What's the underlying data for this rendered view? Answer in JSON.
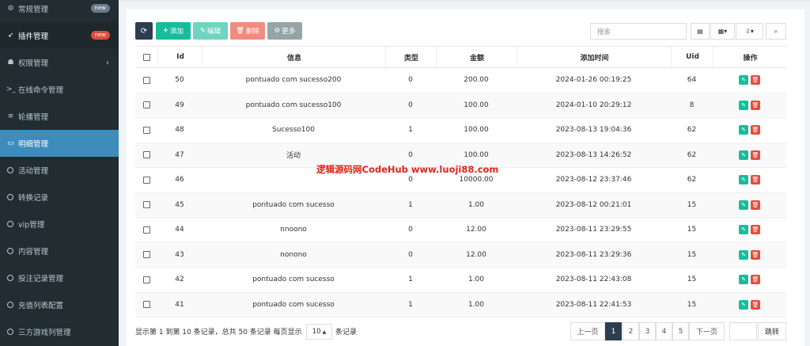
{
  "sidebar": {
    "items": [
      {
        "label": "常规管理",
        "badge": "new"
      },
      {
        "label": "插件管理",
        "badge": "new"
      },
      {
        "label": "权限管理"
      },
      {
        "label": "在线命令管理"
      },
      {
        "label": "轮播管理"
      },
      {
        "label": "明细管理"
      },
      {
        "label": "活动管理"
      },
      {
        "label": "转换记录"
      },
      {
        "label": "vip管理"
      },
      {
        "label": "内容管理"
      },
      {
        "label": "投注记录管理"
      },
      {
        "label": "充值列表配置"
      },
      {
        "label": "三方游戏列管理"
      }
    ]
  },
  "toolbar": {
    "add_label": "添加",
    "edit_label": "编辑",
    "delete_label": "删除",
    "more_label": "更多",
    "search_placeholder": "搜索"
  },
  "table": {
    "headers": {
      "id": "Id",
      "info": "信息",
      "type": "类型",
      "amount": "金额",
      "time": "添加时间",
      "uid": "Uid",
      "ops": "操作"
    },
    "rows": [
      {
        "id": "50",
        "info": "pontuado com sucesso200",
        "type": "0",
        "amount": "200.00",
        "time": "2024-01-26 00:19:25",
        "uid": "64"
      },
      {
        "id": "49",
        "info": "pontuado com sucesso100",
        "type": "0",
        "amount": "100.00",
        "time": "2024-01-10 20:29:12",
        "uid": "8"
      },
      {
        "id": "48",
        "info": "Sucesso100",
        "type": "1",
        "amount": "100.00",
        "time": "2023-08-13 19:04:36",
        "uid": "62"
      },
      {
        "id": "47",
        "info": "活动",
        "type": "0",
        "amount": "100.00",
        "time": "2023-08-13 14:26:52",
        "uid": "62"
      },
      {
        "id": "46",
        "info": "",
        "type": "0",
        "amount": "10000.00",
        "time": "2023-08-12 23:37:46",
        "uid": "62"
      },
      {
        "id": "45",
        "info": "pontuado com sucesso",
        "type": "1",
        "amount": "1.00",
        "time": "2023-08-12 00:21:01",
        "uid": "15"
      },
      {
        "id": "44",
        "info": "nnoono",
        "type": "0",
        "amount": "12.00",
        "time": "2023-08-11 23:29:55",
        "uid": "15"
      },
      {
        "id": "43",
        "info": "nonono",
        "type": "0",
        "amount": "12.00",
        "time": "2023-08-11 23:29:36",
        "uid": "15"
      },
      {
        "id": "42",
        "info": "pontuado com sucesso",
        "type": "1",
        "amount": "1.00",
        "time": "2023-08-11 22:43:08",
        "uid": "15"
      },
      {
        "id": "41",
        "info": "pontuado com sucesso",
        "type": "1",
        "amount": "1.00",
        "time": "2023-08-11 22:41:53",
        "uid": "15"
      }
    ]
  },
  "watermark": "逻辑源码网CodeHub  www.luoji88.com",
  "footer": {
    "summary": "显示第 1 到第 10 条记录，总共 50 条记录 每页显示",
    "page_size": "10",
    "page_size_suffix": "条记录",
    "prev": "上一页",
    "pages": [
      "1",
      "2",
      "3",
      "4",
      "5"
    ],
    "current_page": "1",
    "next": "下一页",
    "jump": "跳转"
  },
  "colors": {
    "sidebar_bg": "#222d32",
    "sidebar_active": "#3c8dbc",
    "refresh_btn": "#2c3e50",
    "add_btn": "#18bc9c",
    "edit_btn": "#6fd4c0",
    "delete_btn": "#f08b80",
    "more_btn": "#95a5a6"
  },
  "icons": [
    "gears-icon",
    "rocket-icon",
    "group-icon",
    "terminal-icon",
    "bars-icon",
    "calendar-icon",
    "circle-icon",
    "refresh-icon",
    "plus-icon",
    "pencil-icon",
    "trash-icon",
    "cog-icon",
    "table-icon",
    "grid-icon",
    "export-icon",
    "search-icon"
  ]
}
